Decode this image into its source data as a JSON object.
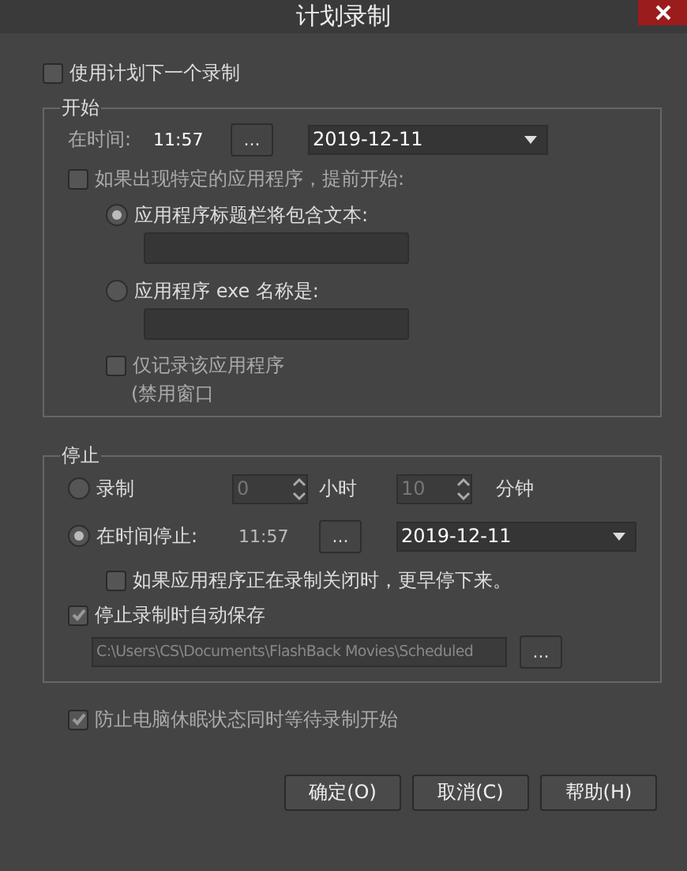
{
  "window": {
    "title": "计划录制"
  },
  "use_schedule": {
    "label": "使用计划下一个录制",
    "checked": false
  },
  "start": {
    "title": "开始",
    "at_time_label": "在时间:",
    "time": "11:57",
    "time_button": "...",
    "date": "2019-12-11",
    "app_checkbox": {
      "label": "如果出现特定的应用程序，提前开始:",
      "checked": false
    },
    "radios": [
      {
        "label": "应用程序标题栏将包含文本:",
        "selected": true
      },
      {
        "label": "应用程序 exe 名称是:",
        "selected": false
      }
    ],
    "only_app": {
      "label": "仅记录该应用程序",
      "note": "(禁用窗口",
      "checked": false
    }
  },
  "stop": {
    "title": "停止",
    "record_radio": {
      "label": "录制",
      "selected": false
    },
    "hours": "0",
    "hours_unit": "小时",
    "minutes": "10",
    "minutes_unit": "分钟",
    "at_time_radio": {
      "label": "在时间停止:",
      "selected": true
    },
    "time": "11:57",
    "time_button": "...",
    "date": "2019-12-11",
    "app_close": {
      "label": "如果应用程序正在录制关闭时，更早停下来。",
      "checked": false
    },
    "autosave": {
      "label": "停止录制时自动保存",
      "checked": true
    },
    "path": "C:\\Users\\CS\\Documents\\FlashBack Movies\\Scheduled",
    "path_button": "..."
  },
  "prevent_sleep": {
    "label": "防止电脑休眠状态同时等待录制开始",
    "checked": true
  },
  "buttons": [
    "确定(O)",
    "取消(C)",
    "帮助(H)"
  ]
}
